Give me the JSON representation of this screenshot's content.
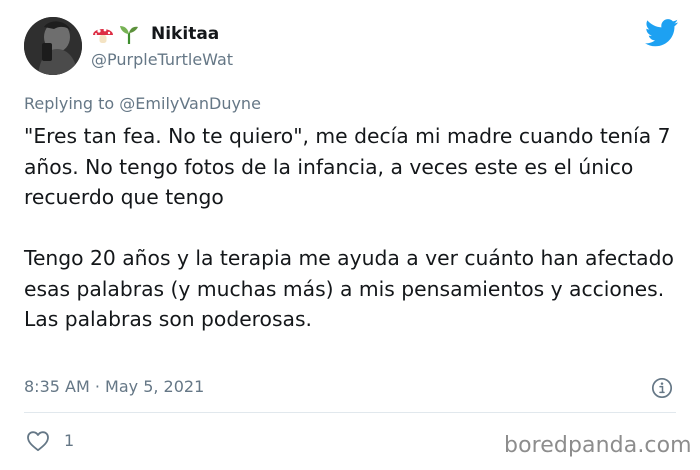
{
  "user": {
    "display_name": "Nikitaa",
    "name_emojis": [
      "mushroom-emoji",
      "seedling-emoji"
    ],
    "handle": "@PurpleTurtleWat"
  },
  "reply": {
    "prefix": "Replying to",
    "to_handle": "@EmilyVanDuyne"
  },
  "tweet": {
    "paragraphs": [
      "\"Eres tan fea. No te quiero\", me decía mi madre cuando tenía 7 años. No tengo fotos de la infancia, a veces este es el único recuerdo que tengo",
      "Tengo 20 años y la terapia me ayuda a ver cuánto han afectado esas palabras (y muchas más) a mis pensamientos y acciones. Las palabras son poderosas."
    ],
    "timestamp": "8:35 AM · May 5, 2021",
    "likes": "1"
  },
  "watermark": "boredpanda.com",
  "colors": {
    "twitter_blue": "#1da1f2",
    "secondary_text": "#657786",
    "primary_text": "#14171a",
    "divider": "#e1e8ed"
  }
}
